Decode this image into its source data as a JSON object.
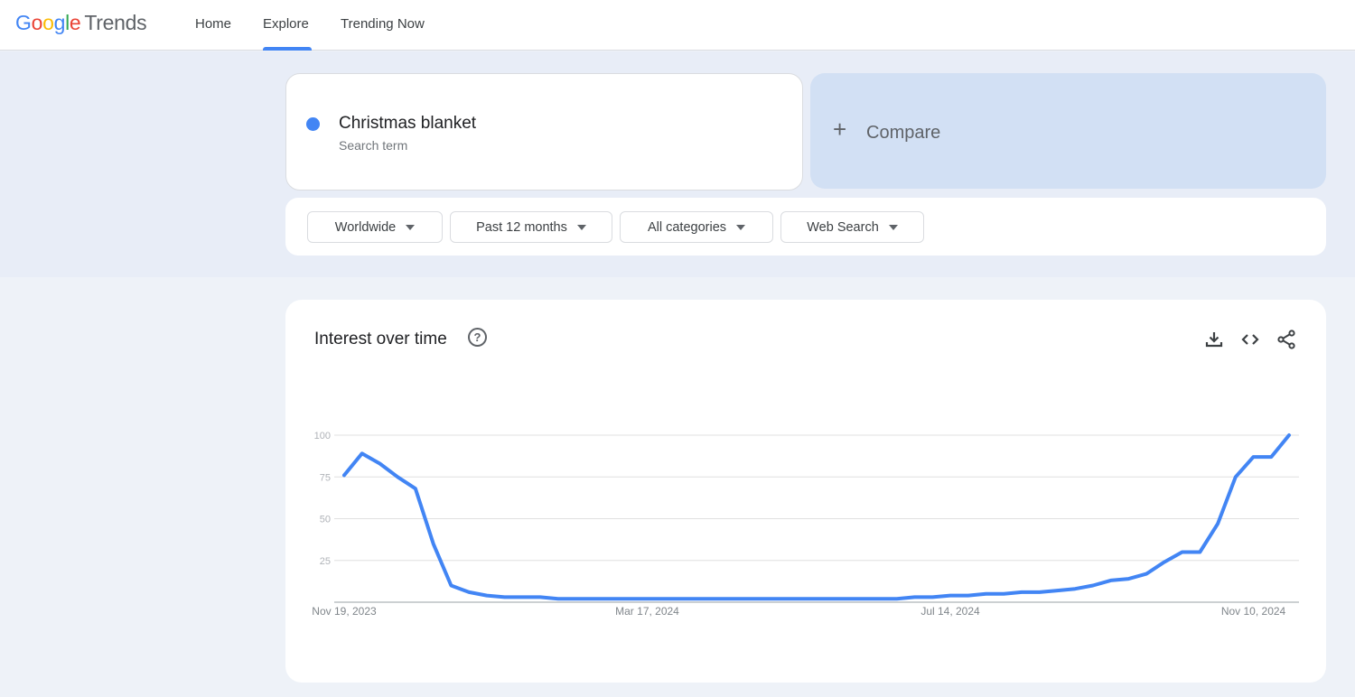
{
  "header": {
    "logo": {
      "google": [
        "G",
        "o",
        "o",
        "g",
        "l",
        "e"
      ],
      "product": "Trends"
    },
    "nav": [
      {
        "label": "Home",
        "active": false
      },
      {
        "label": "Explore",
        "active": true
      },
      {
        "label": "Trending Now",
        "active": false
      }
    ],
    "accent_color": "#4285f4"
  },
  "search": {
    "term": "Christmas blanket",
    "term_type": "Search term",
    "term_color": "#4285f4",
    "compare_label": "Compare",
    "compare_icon": "plus-icon"
  },
  "filters": {
    "region": "Worldwide",
    "time_range": "Past 12 months",
    "category": "All categories",
    "search_type": "Web Search"
  },
  "panel": {
    "title": "Interest over time",
    "help_icon": "help-circle-icon",
    "actions": [
      "download-icon",
      "embed-code-icon",
      "share-icon"
    ]
  },
  "chart_data": {
    "type": "line",
    "title": "Interest over time",
    "xlabel": "",
    "ylabel": "",
    "ylim": [
      0,
      100
    ],
    "y_ticks": [
      25,
      50,
      75,
      100
    ],
    "x_tick_labels": [
      {
        "label": "Nov 19, 2023",
        "index": 0
      },
      {
        "label": "Mar 17, 2024",
        "index": 17
      },
      {
        "label": "Jul 14, 2024",
        "index": 34
      },
      {
        "label": "Nov 10, 2024",
        "index": 51
      }
    ],
    "grid": true,
    "legend": "none",
    "series": [
      {
        "name": "Christmas blanket",
        "color": "#4285f4",
        "values": [
          76,
          89,
          83,
          75,
          68,
          35,
          10,
          6,
          4,
          3,
          3,
          3,
          2,
          2,
          2,
          2,
          2,
          2,
          2,
          2,
          2,
          2,
          2,
          2,
          2,
          2,
          2,
          2,
          2,
          2,
          2,
          2,
          3,
          3,
          4,
          4,
          5,
          5,
          6,
          6,
          7,
          8,
          10,
          13,
          14,
          17,
          24,
          30,
          30,
          47,
          75,
          87,
          87,
          100
        ]
      }
    ]
  }
}
